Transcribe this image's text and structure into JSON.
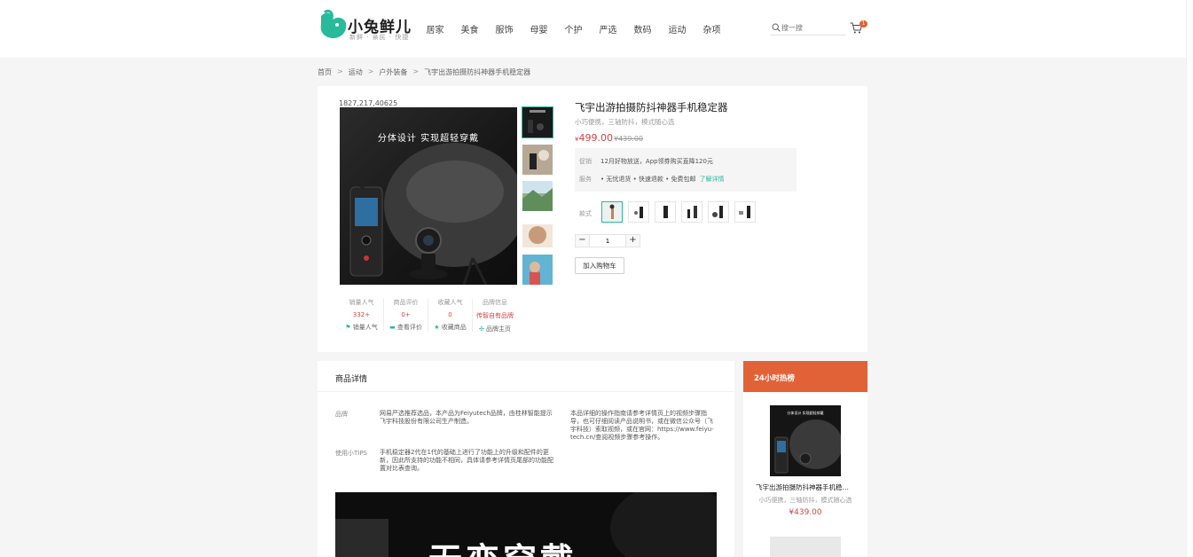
{
  "header": {
    "logo_text": "小兔鲜儿",
    "logo_sub": "新鲜 · 亲民 · 快捷",
    "nav": [
      "居家",
      "美食",
      "服饰",
      "母婴",
      "个护",
      "严选",
      "数码",
      "运动",
      "杂项"
    ],
    "search_placeholder": "搜一搜",
    "cart_count": "1",
    "accent": "#27ba9b"
  },
  "breadcrumb": [
    "首页",
    "运动",
    "户外装备",
    "飞宇出游拍摄防抖神器手机稳定器"
  ],
  "product": {
    "sku_id": "1827,217,40625",
    "main_image_title": "分体设计  实现超轻穿戴",
    "title": "飞宇出游拍摄防抖神器手机稳定器",
    "desc": "小巧便携，三轴防抖，模式随心选",
    "price_symbol": "¥",
    "price": "499.00",
    "old_price": "¥439.00",
    "promo_label": "促销",
    "promo_text": "12月好物放送，App领券购买直降120元",
    "service_label": "服务",
    "service_text": "• 无忧退货  • 快速退款  • 免费包邮",
    "service_link": "了解详情",
    "style_label": "款式",
    "quantity": "1",
    "add_cart_label": "加入购物车",
    "price_color": "#cf4444"
  },
  "stats": [
    {
      "label": "销量人气",
      "value": "332+",
      "link": "销量人气",
      "icon": "flag-icon"
    },
    {
      "label": "商品评价",
      "value": "0+",
      "link": "查看评价",
      "icon": "comment-icon"
    },
    {
      "label": "收藏人气",
      "value": "0",
      "link": "收藏商品",
      "icon": "star-icon"
    },
    {
      "label": "品牌信息",
      "value": "传智自有品牌",
      "link": "品牌主页",
      "icon": "brand-icon"
    }
  ],
  "details": {
    "heading": "商品详情",
    "attrs": [
      {
        "name": "品牌",
        "value": "网易严选推荐选品，本产品为Feiyutech品牌，由桂林智能提示飞宇科技股份有限公司生产制造。"
      },
      {
        "name": "使用小TIPS",
        "value": "手机稳定器2代在1代的基础上进行了功能上的升级和配件的更新，因此所支持的功能不相同，具体请参考详情页尾部的功能配置对比表查询。"
      },
      {
        "name": "",
        "value": "本品详细的操作指南请参考详情页上的视频步骤指导，也可仔细阅读产品说明书，或在微信公众号（飞宇科技）索取视频，或在官网：https://www.feiyu-tech.cn/查阅视频步骤参考操作。"
      }
    ],
    "image_text": "无恋穿戴"
  },
  "hot": {
    "heading": "24小时热榜",
    "items": [
      {
        "name": "飞宇出游拍摄防抖神器手机稳定器",
        "desc": "小巧便携，三轴防抖，模式随心选",
        "price": "¥439.00",
        "image_text": "分体设计  实现超轻穿戴"
      }
    ],
    "accent": "#e26237"
  }
}
